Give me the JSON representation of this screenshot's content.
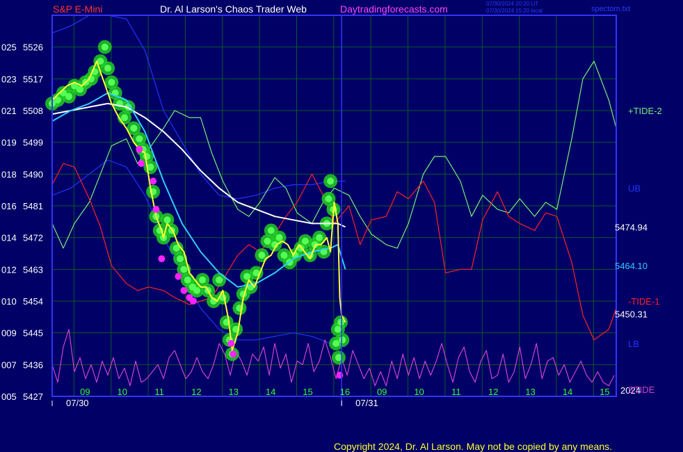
{
  "header": {
    "symbol": "S&P E-Mini",
    "site": "Dr. Al Larson's Chaos Trader Web",
    "url": "Daytradingforecasts.com",
    "utc_time": "07/30/2024 20:20 UT",
    "local_time": "07/30/2024 15:20 local",
    "file": "spectom.txt"
  },
  "footer": {
    "copyright": "Copyright 2024, Dr. Al Larson. May not be copied by any means."
  },
  "colors": {
    "background": "#000066",
    "plot_border": "#3333ff",
    "grid": "#0a5a2a",
    "price": "#ffff33",
    "cloud": "#22cc22",
    "magenta_dots": "#ff22ff",
    "ema_cyan": "#33ccff",
    "ema_white": "#ffffff",
    "tide_plus": "#77ee77",
    "tide_minus": "#ff2222",
    "band": "#2233ff",
    "stide": "#cc44cc",
    "session_line": "#3333ff"
  },
  "chart_data": {
    "type": "line",
    "title": "S&P E-Mini",
    "ylim": [
      5427,
      5535
    ],
    "xlim": [
      8.0,
      23.2
    ],
    "y_ticks": [
      {
        "value": 5526,
        "left": "025",
        "right": "5526"
      },
      {
        "value": 5517,
        "left": "023",
        "right": "5517"
      },
      {
        "value": 5508,
        "left": "021",
        "right": "5508"
      },
      {
        "value": 5499,
        "left": "019",
        "right": "5499"
      },
      {
        "value": 5490,
        "left": "018",
        "right": "5490"
      },
      {
        "value": 5481,
        "left": "016",
        "right": "5481"
      },
      {
        "value": 5472,
        "left": "014",
        "right": "5472"
      },
      {
        "value": 5463,
        "left": "012",
        "right": "5463"
      },
      {
        "value": 5454,
        "left": "010",
        "right": "5454"
      },
      {
        "value": 5445,
        "left": "009",
        "right": "5445"
      },
      {
        "value": 5436,
        "left": "007",
        "right": "5436"
      },
      {
        "value": 5427,
        "left": "005",
        "right": "5427"
      }
    ],
    "x_ticks": [
      {
        "value": 9,
        "label": "09"
      },
      {
        "value": 10,
        "label": "10"
      },
      {
        "value": 11,
        "label": "11"
      },
      {
        "value": 12,
        "label": "12"
      },
      {
        "value": 13,
        "label": "13"
      },
      {
        "value": 14,
        "label": "14"
      },
      {
        "value": 15,
        "label": "15"
      },
      {
        "value": 16,
        "label": "16"
      },
      {
        "value": 17,
        "label": "09"
      },
      {
        "value": 18,
        "label": "10"
      },
      {
        "value": 19,
        "label": "11"
      },
      {
        "value": 20,
        "label": "12"
      },
      {
        "value": 21,
        "label": "13"
      },
      {
        "value": 22,
        "label": "14"
      },
      {
        "value": 23,
        "label": "15"
      },
      {
        "value": 23.9,
        "label": "16"
      }
    ],
    "date_labels": [
      {
        "x": 8.0,
        "label": "07/30"
      },
      {
        "x": 15.8,
        "label": "07/31"
      }
    ],
    "year_label": "2024",
    "session_break_x": 15.8,
    "right_values": [
      {
        "label": "5474.94",
        "y": 5474.94,
        "color": "#ffffff"
      },
      {
        "label": "5464.10",
        "y": 5464.1,
        "color": "#33ccff"
      },
      {
        "label": "5450.31",
        "y": 5450.31,
        "color": "#ffffff"
      }
    ],
    "right_labels": [
      {
        "label": "+TIDE-2",
        "y": 5508,
        "color": "#77ee77"
      },
      {
        "label": "UB",
        "y": 5486,
        "color": "#2233ff"
      },
      {
        "label": "-TIDE-1",
        "y": 5454,
        "color": "#ff2222"
      },
      {
        "label": "LB",
        "y": 5442,
        "color": "#2233ff"
      },
      {
        "label": "STIDE",
        "y": 5429,
        "color": "#cc44cc"
      }
    ],
    "series": [
      {
        "key": "price",
        "x": [
          8.0,
          8.2,
          8.4,
          8.6,
          8.8,
          9.0,
          9.2,
          9.4,
          9.6,
          9.8,
          10.0,
          10.2,
          10.35,
          10.5,
          10.65,
          10.8,
          10.95,
          11.0,
          11.1,
          11.25,
          11.4,
          11.55,
          11.7,
          11.85,
          12.0,
          12.15,
          12.3,
          12.45,
          12.6,
          12.75,
          12.85,
          13.0,
          13.15,
          13.3,
          13.45,
          13.6,
          13.75,
          13.9,
          14.05,
          14.2,
          14.35,
          14.5,
          14.65,
          14.8,
          14.95,
          15.1,
          15.25,
          15.4,
          15.5,
          15.6,
          15.7,
          15.75,
          15.8,
          15.9
        ],
        "y": [
          5511,
          5513,
          5515,
          5516,
          5515,
          5517,
          5522,
          5516,
          5510,
          5506,
          5503,
          5499,
          5497,
          5496,
          5486,
          5478,
          5474,
          5472,
          5476,
          5474,
          5470,
          5468,
          5462,
          5460,
          5458,
          5458,
          5455,
          5454,
          5457,
          5449,
          5440,
          5445,
          5455,
          5460,
          5458,
          5462,
          5466,
          5467,
          5470,
          5471,
          5470,
          5467,
          5470,
          5468,
          5466,
          5470,
          5470,
          5472,
          5468,
          5482,
          5476,
          5455,
          5450,
          5448
        ]
      },
      {
        "key": "ema_cyan",
        "x": [
          8.0,
          8.5,
          9.0,
          9.5,
          10.0,
          10.5,
          11.0,
          11.5,
          12.0,
          12.5,
          13.0,
          13.5,
          14.0,
          14.5,
          15.0,
          15.5,
          15.7,
          15.9
        ],
        "y": [
          5505,
          5508,
          5510,
          5513,
          5511,
          5502,
          5488,
          5476,
          5468,
          5462,
          5458,
          5459,
          5462,
          5466,
          5468,
          5469,
          5470,
          5463
        ]
      },
      {
        "key": "ema_white",
        "x": [
          8.0,
          8.5,
          9.0,
          9.5,
          10.0,
          10.5,
          11.0,
          11.5,
          12.0,
          12.5,
          13.0,
          13.5,
          14.0,
          14.5,
          15.0,
          15.5,
          15.7,
          15.9
        ],
        "y": [
          5507,
          5508,
          5509,
          5510,
          5509,
          5506,
          5502,
          5497,
          5491,
          5486,
          5482,
          5480,
          5478,
          5477,
          5476,
          5476,
          5476,
          5475
        ]
      },
      {
        "key": "tide_plus",
        "x": [
          8.0,
          8.3,
          8.6,
          9.0,
          9.3,
          9.6,
          10.0,
          10.3,
          10.6,
          11.0,
          11.3,
          11.7,
          12.0,
          12.3,
          12.6,
          13.0,
          13.3,
          13.6,
          14.0,
          14.3,
          14.6,
          15.0,
          15.3,
          15.6,
          16.0,
          16.3,
          16.6,
          17.0,
          17.3,
          17.6,
          18.0,
          18.3,
          18.6,
          19.0,
          19.3,
          19.6,
          20.0,
          20.3,
          20.6,
          21.0,
          21.3,
          21.6,
          22.0,
          22.3,
          22.6,
          23.0,
          23.2
        ],
        "y": [
          5476,
          5469,
          5476,
          5482,
          5490,
          5498,
          5500,
          5493,
          5497,
          5503,
          5508,
          5506,
          5506,
          5496,
          5488,
          5480,
          5478,
          5482,
          5489,
          5486,
          5479,
          5476,
          5482,
          5486,
          5484,
          5478,
          5473,
          5470,
          5469,
          5476,
          5490,
          5495,
          5495,
          5488,
          5478,
          5484,
          5480,
          5479,
          5483,
          5478,
          5482,
          5480,
          5500,
          5517,
          5522,
          5511,
          5503
        ]
      },
      {
        "key": "tide_minus",
        "x": [
          8.0,
          8.3,
          8.6,
          9.0,
          9.3,
          9.6,
          10.0,
          10.3,
          10.6,
          11.0,
          11.3,
          11.7,
          12.0,
          12.3,
          12.6,
          13.0,
          13.3,
          13.6,
          14.0,
          14.3,
          14.6,
          15.0,
          15.3,
          15.6,
          16.0,
          16.3,
          16.6,
          17.0,
          17.3,
          17.6,
          18.0,
          18.3,
          18.6,
          19.0,
          19.3,
          19.6,
          20.0,
          20.3,
          20.6,
          21.0,
          21.3,
          21.6,
          22.0,
          22.3,
          22.6,
          23.0,
          23.2
        ],
        "y": [
          5487,
          5493,
          5492,
          5483,
          5475,
          5464,
          5459,
          5457,
          5458,
          5457,
          5455,
          5453,
          5454,
          5455,
          5460,
          5467,
          5470,
          5468,
          5473,
          5478,
          5482,
          5490,
          5484,
          5476,
          5481,
          5470,
          5477,
          5478,
          5485,
          5483,
          5488,
          5482,
          5462,
          5463,
          5463,
          5477,
          5485,
          5478,
          5476,
          5474,
          5479,
          5478,
          5465,
          5450,
          5443,
          5446,
          5452
        ]
      },
      {
        "key": "ub",
        "x": [
          8.0,
          8.5,
          9.0,
          9.5,
          10.0,
          10.5,
          11.0,
          11.5,
          12.0,
          12.5,
          13.0,
          13.5,
          14.0,
          14.5,
          15.0,
          15.5,
          15.9
        ],
        "y": [
          5530,
          5532,
          5535,
          5535,
          5534,
          5525,
          5508,
          5499,
          5490,
          5484,
          5483,
          5484,
          5486,
          5487,
          5487,
          5488,
          5488
        ]
      },
      {
        "key": "lb",
        "x": [
          8.0,
          8.5,
          9.0,
          9.5,
          10.0,
          10.5,
          11.0,
          11.5,
          12.0,
          12.5,
          13.0,
          13.5,
          14.0,
          14.5,
          15.0,
          15.5,
          15.9
        ],
        "y": [
          5484,
          5486,
          5490,
          5494,
          5492,
          5484,
          5472,
          5462,
          5452,
          5446,
          5443,
          5443,
          5444,
          5445,
          5444,
          5442,
          5441
        ]
      },
      {
        "key": "stide",
        "x": [
          8.0,
          8.15,
          8.3,
          8.45,
          8.6,
          8.75,
          8.9,
          9.05,
          9.2,
          9.35,
          9.5,
          9.65,
          9.8,
          9.95,
          10.1,
          10.25,
          10.4,
          10.55,
          10.7,
          10.85,
          11.0,
          11.15,
          11.3,
          11.45,
          11.6,
          11.75,
          11.9,
          12.05,
          12.2,
          12.35,
          12.5,
          12.65,
          12.8,
          12.95,
          13.1,
          13.25,
          13.4,
          13.55,
          13.7,
          13.85,
          14.0,
          14.15,
          14.3,
          14.45,
          14.6,
          14.75,
          14.9,
          15.05,
          15.2,
          15.35,
          15.5,
          15.65,
          15.8,
          15.95,
          16.1,
          16.25,
          16.4,
          16.55,
          16.7,
          16.85,
          17.0,
          17.15,
          17.3,
          17.45,
          17.6,
          17.75,
          17.9,
          18.05,
          18.2,
          18.35,
          18.5,
          18.65,
          18.8,
          18.95,
          19.1,
          19.25,
          19.4,
          19.55,
          19.7,
          19.85,
          20.0,
          20.15,
          20.3,
          20.45,
          20.6,
          20.75,
          20.9,
          21.05,
          21.2,
          21.35,
          21.5,
          21.65,
          21.8,
          21.95,
          22.1,
          22.25,
          22.4,
          22.55,
          22.7,
          22.85,
          23.0,
          23.15
        ],
        "y": [
          5436,
          5431,
          5441,
          5446,
          5434,
          5438,
          5432,
          5436,
          5431,
          5437,
          5433,
          5438,
          5432,
          5435,
          5430,
          5437,
          5431,
          5432,
          5434,
          5436,
          5432,
          5438,
          5440,
          5436,
          5432,
          5434,
          5438,
          5434,
          5432,
          5436,
          5442,
          5439,
          5433,
          5440,
          5437,
          5433,
          5439,
          5437,
          5441,
          5433,
          5442,
          5435,
          5439,
          5431,
          5437,
          5436,
          5442,
          5434,
          5437,
          5443,
          5438,
          5432,
          5438,
          5433,
          5440,
          5436,
          5432,
          5435,
          5430,
          5434,
          5430,
          5437,
          5432,
          5439,
          5433,
          5438,
          5432,
          5437,
          5433,
          5437,
          5442,
          5436,
          5431,
          5438,
          5441,
          5434,
          5431,
          5437,
          5440,
          5432,
          5433,
          5439,
          5431,
          5434,
          5441,
          5432,
          5436,
          5442,
          5432,
          5437,
          5438,
          5433,
          5436,
          5431,
          5434,
          5437,
          5433,
          5431,
          5434,
          5431,
          5430,
          5433
        ]
      }
    ],
    "cloud_points": [
      {
        "x": 8.0,
        "y": 5510
      },
      {
        "x": 8.15,
        "y": 5511
      },
      {
        "x": 8.3,
        "y": 5513
      },
      {
        "x": 8.45,
        "y": 5512
      },
      {
        "x": 8.6,
        "y": 5515
      },
      {
        "x": 8.75,
        "y": 5514
      },
      {
        "x": 8.9,
        "y": 5516
      },
      {
        "x": 9.05,
        "y": 5517
      },
      {
        "x": 9.15,
        "y": 5519
      },
      {
        "x": 9.3,
        "y": 5522
      },
      {
        "x": 9.42,
        "y": 5526
      },
      {
        "x": 9.5,
        "y": 5520
      },
      {
        "x": 9.6,
        "y": 5516
      },
      {
        "x": 9.7,
        "y": 5513
      },
      {
        "x": 9.82,
        "y": 5510
      },
      {
        "x": 9.95,
        "y": 5506
      },
      {
        "x": 10.05,
        "y": 5509
      },
      {
        "x": 10.2,
        "y": 5503
      },
      {
        "x": 10.35,
        "y": 5500
      },
      {
        "x": 10.45,
        "y": 5497
      },
      {
        "x": 10.55,
        "y": 5495
      },
      {
        "x": 10.65,
        "y": 5492
      },
      {
        "x": 10.72,
        "y": 5485
      },
      {
        "x": 10.8,
        "y": 5478
      },
      {
        "x": 10.9,
        "y": 5474
      },
      {
        "x": 11.0,
        "y": 5472
      },
      {
        "x": 11.1,
        "y": 5477
      },
      {
        "x": 11.22,
        "y": 5474
      },
      {
        "x": 11.35,
        "y": 5469
      },
      {
        "x": 11.45,
        "y": 5466
      },
      {
        "x": 11.55,
        "y": 5463
      },
      {
        "x": 11.65,
        "y": 5460
      },
      {
        "x": 11.78,
        "y": 5458
      },
      {
        "x": 11.9,
        "y": 5457
      },
      {
        "x": 12.05,
        "y": 5460
      },
      {
        "x": 12.2,
        "y": 5457
      },
      {
        "x": 12.35,
        "y": 5454
      },
      {
        "x": 12.5,
        "y": 5460
      },
      {
        "x": 12.6,
        "y": 5455
      },
      {
        "x": 12.7,
        "y": 5448
      },
      {
        "x": 12.78,
        "y": 5443
      },
      {
        "x": 12.85,
        "y": 5439
      },
      {
        "x": 12.95,
        "y": 5446
      },
      {
        "x": 13.05,
        "y": 5452
      },
      {
        "x": 13.15,
        "y": 5456
      },
      {
        "x": 13.25,
        "y": 5461
      },
      {
        "x": 13.35,
        "y": 5458
      },
      {
        "x": 13.5,
        "y": 5462
      },
      {
        "x": 13.65,
        "y": 5467
      },
      {
        "x": 13.8,
        "y": 5471
      },
      {
        "x": 13.9,
        "y": 5474
      },
      {
        "x": 14.0,
        "y": 5470
      },
      {
        "x": 14.12,
        "y": 5472
      },
      {
        "x": 14.25,
        "y": 5467
      },
      {
        "x": 14.4,
        "y": 5465
      },
      {
        "x": 14.55,
        "y": 5467
      },
      {
        "x": 14.7,
        "y": 5469
      },
      {
        "x": 14.82,
        "y": 5471
      },
      {
        "x": 14.95,
        "y": 5467
      },
      {
        "x": 15.08,
        "y": 5470
      },
      {
        "x": 15.2,
        "y": 5472
      },
      {
        "x": 15.32,
        "y": 5468
      },
      {
        "x": 15.4,
        "y": 5476
      },
      {
        "x": 15.45,
        "y": 5483
      },
      {
        "x": 15.5,
        "y": 5488
      },
      {
        "x": 15.58,
        "y": 5480
      },
      {
        "x": 15.65,
        "y": 5442
      },
      {
        "x": 15.7,
        "y": 5446
      },
      {
        "x": 15.72,
        "y": 5438
      },
      {
        "x": 15.78,
        "y": 5448
      },
      {
        "x": 15.82,
        "y": 5443
      }
    ],
    "magenta_points": [
      {
        "x": 10.35,
        "y": 5497
      },
      {
        "x": 10.4,
        "y": 5493
      },
      {
        "x": 10.72,
        "y": 5488
      },
      {
        "x": 10.8,
        "y": 5480
      },
      {
        "x": 10.95,
        "y": 5466
      },
      {
        "x": 11.4,
        "y": 5461
      },
      {
        "x": 11.55,
        "y": 5457
      },
      {
        "x": 11.7,
        "y": 5455
      },
      {
        "x": 11.8,
        "y": 5454
      },
      {
        "x": 12.82,
        "y": 5442
      },
      {
        "x": 12.88,
        "y": 5439
      },
      {
        "x": 15.75,
        "y": 5433
      }
    ]
  }
}
